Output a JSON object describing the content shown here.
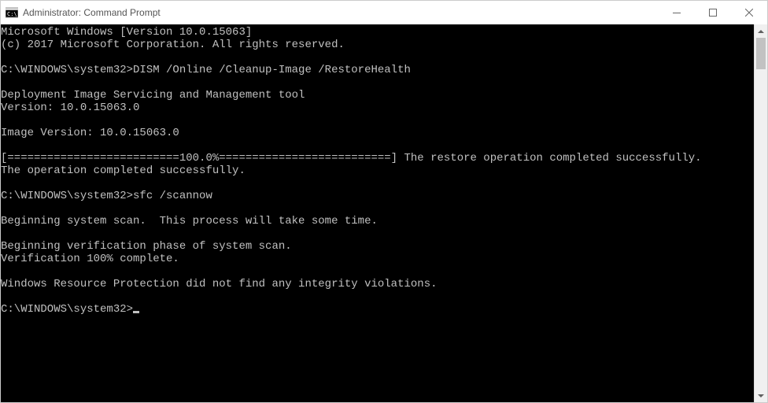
{
  "window": {
    "title": "Administrator: Command Prompt"
  },
  "terminal": {
    "lines": [
      "Microsoft Windows [Version 10.0.15063]",
      "(c) 2017 Microsoft Corporation. All rights reserved.",
      "",
      "C:\\WINDOWS\\system32>DISM /Online /Cleanup-Image /RestoreHealth",
      "",
      "Deployment Image Servicing and Management tool",
      "Version: 10.0.15063.0",
      "",
      "Image Version: 10.0.15063.0",
      "",
      "[==========================100.0%==========================] The restore operation completed successfully.",
      "The operation completed successfully.",
      "",
      "C:\\WINDOWS\\system32>sfc /scannow",
      "",
      "Beginning system scan.  This process will take some time.",
      "",
      "Beginning verification phase of system scan.",
      "Verification 100% complete.",
      "",
      "Windows Resource Protection did not find any integrity violations.",
      "",
      "C:\\WINDOWS\\system32>"
    ],
    "prompt_has_cursor": true
  }
}
